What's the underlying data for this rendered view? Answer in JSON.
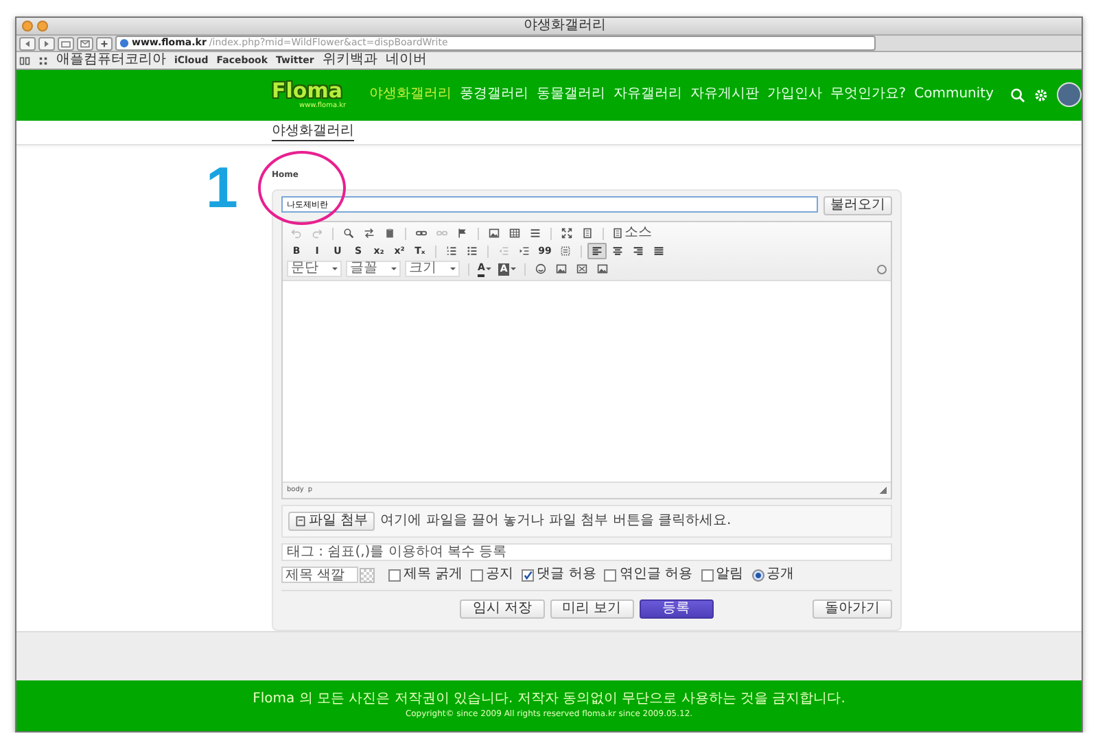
{
  "browser": {
    "title": "야생화갤러리",
    "url_host": "www.floma.kr",
    "url_path": "/index.php?mid=WildFlower&act=dispBoardWrite",
    "bookmarks": [
      "애플컴퓨터코리아",
      "iCloud",
      "Facebook",
      "Twitter",
      "위키백과",
      "네이버"
    ]
  },
  "site": {
    "logo": "Floma",
    "logo_sub": "www.floma.kr",
    "nav": [
      {
        "label": "야생화갤러리",
        "selected": true
      },
      {
        "label": "풍경갤러리",
        "selected": false
      },
      {
        "label": "동물갤러리",
        "selected": false
      },
      {
        "label": "자유갤러리",
        "selected": false
      },
      {
        "label": "자유게시판",
        "selected": false
      },
      {
        "label": "가입인사",
        "selected": false
      },
      {
        "label": "무엇인가요?",
        "selected": false
      },
      {
        "label": "Community",
        "selected": false
      }
    ]
  },
  "page_title": "야생화갤러리",
  "breadcrumb": "Home",
  "annotation": "1",
  "form": {
    "title_value": "나도제비란",
    "load_button": "불러오기",
    "toolbar": [
      [
        {
          "kind": "undo",
          "disabled": true
        },
        {
          "kind": "redo",
          "disabled": true
        },
        {
          "kind": "sep"
        },
        {
          "kind": "find"
        },
        {
          "kind": "replace"
        },
        {
          "kind": "paste"
        },
        {
          "kind": "sep"
        },
        {
          "kind": "link"
        },
        {
          "kind": "unlink",
          "disabled": true
        },
        {
          "kind": "flag"
        },
        {
          "kind": "sep"
        },
        {
          "kind": "image"
        },
        {
          "kind": "table"
        },
        {
          "kind": "hr"
        },
        {
          "kind": "sep"
        },
        {
          "kind": "maximize"
        },
        {
          "kind": "blocks"
        },
        {
          "kind": "sep"
        },
        {
          "kind": "source",
          "label": "소스"
        }
      ],
      [
        {
          "kind": "glyph",
          "label": "B"
        },
        {
          "kind": "glyph",
          "label": "I"
        },
        {
          "kind": "glyph",
          "label": "U"
        },
        {
          "kind": "glyph",
          "label": "S"
        },
        {
          "kind": "glyph",
          "label": "x₂"
        },
        {
          "kind": "glyph",
          "label": "x²"
        },
        {
          "kind": "glyph",
          "label": "Tₓ"
        },
        {
          "kind": "sep"
        },
        {
          "kind": "ol"
        },
        {
          "kind": "ul"
        },
        {
          "kind": "sep"
        },
        {
          "kind": "outdent",
          "disabled": true
        },
        {
          "kind": "indent"
        },
        {
          "kind": "glyph",
          "label": "99"
        },
        {
          "kind": "div"
        },
        {
          "kind": "sep"
        },
        {
          "kind": "alignleft",
          "selected": true
        },
        {
          "kind": "aligncenter",
          "selected": false
        },
        {
          "kind": "alignright",
          "selected": false
        },
        {
          "kind": "justify",
          "selected": false
        }
      ],
      [
        {
          "kind": "select",
          "label": "문단"
        },
        {
          "kind": "select",
          "label": "글꼴"
        },
        {
          "kind": "select",
          "label": "크기"
        },
        {
          "kind": "sep"
        },
        {
          "kind": "color",
          "label": "A"
        },
        {
          "kind": "bgcolor",
          "label": "A"
        },
        {
          "kind": "sep"
        },
        {
          "kind": "smiley"
        },
        {
          "kind": "image"
        },
        {
          "kind": "frame"
        },
        {
          "kind": "image"
        }
      ]
    ],
    "status": [
      "body",
      "p"
    ],
    "attach_button": "파일 첨부",
    "attach_hint": "여기에 파일을 끌어 놓거나 파일 첨부 버튼을 클릭하세요.",
    "tag_placeholder": "태그 : 쉼표(,)를 이용하여 복수 등록",
    "title_color_placeholder": "제목 색깔",
    "options": [
      {
        "kind": "checkbox",
        "label": "제목 굵게",
        "checked": false
      },
      {
        "kind": "checkbox",
        "label": "공지",
        "checked": false
      },
      {
        "kind": "checkbox",
        "label": "댓글 허용",
        "checked": true
      },
      {
        "kind": "checkbox",
        "label": "엮인글 허용",
        "checked": false
      },
      {
        "kind": "checkbox",
        "label": "알림",
        "checked": false
      },
      {
        "kind": "radio",
        "label": "공개",
        "checked": true
      }
    ],
    "buttons": [
      {
        "label": "임시 저장",
        "kind": "normal"
      },
      {
        "label": "미리 보기",
        "kind": "normal"
      },
      {
        "label": "등록",
        "kind": "primary"
      },
      {
        "label": "돌아가기",
        "kind": "back"
      }
    ]
  },
  "footer": {
    "notice": "Floma 의 모든 사진은 저작권이 있습니다. 저작자 동의없이 무단으로 사용하는 것을 금지합니다.",
    "copyright": "Copyright© since 2009 All rights reserved floma.kr since 2009.05.12."
  }
}
